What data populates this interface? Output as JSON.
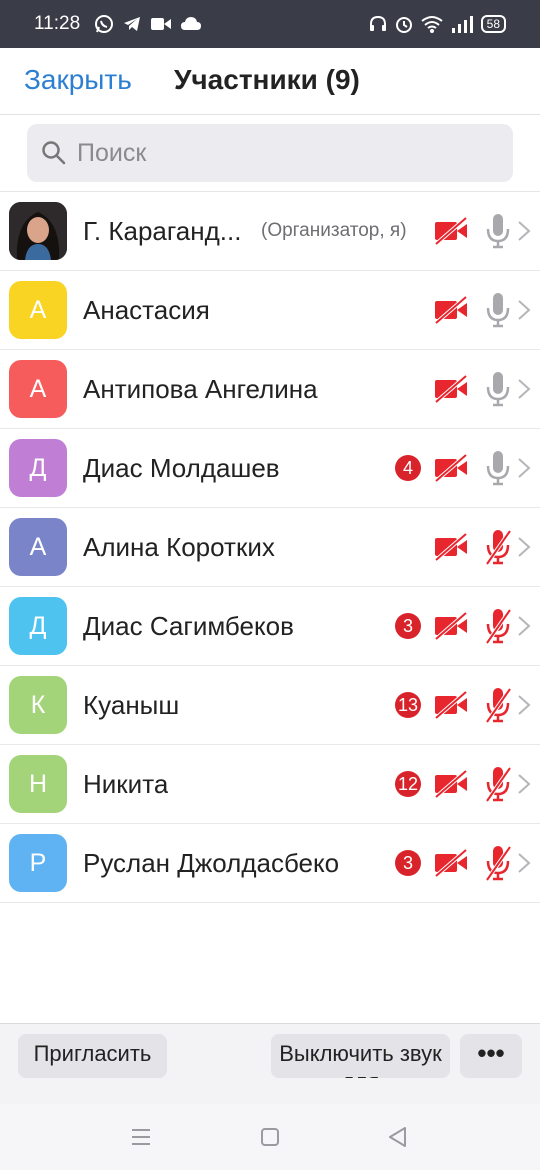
{
  "status": {
    "time": "11:28",
    "battery": "58",
    "left_icons": [
      "whatsapp-icon",
      "telegram-icon",
      "video-icon",
      "cloud-icon"
    ],
    "right_icons": [
      "headphones-icon",
      "alarm-icon",
      "wifi-icon",
      "signal-icon",
      "battery-icon"
    ]
  },
  "header": {
    "close_label": "Закрыть",
    "title": "Участники (9)"
  },
  "search": {
    "placeholder": "Поиск",
    "value": ""
  },
  "colors": {
    "accent": "#2d7fd1",
    "muted_red": "#e8262e",
    "badge_red": "#d8232a",
    "mic_gray": "#a9a9ad"
  },
  "participants": [
    {
      "name": "Г. Караганд...",
      "role": "(Организатор, я)",
      "initial": "",
      "avatar_color": "#2b2b2b",
      "photo": true,
      "unread": "",
      "video_off": true,
      "mic_muted": false
    },
    {
      "name": "Анастасия",
      "role": "",
      "initial": "А",
      "avatar_color": "#f9d423",
      "photo": false,
      "unread": "",
      "video_off": true,
      "mic_muted": false
    },
    {
      "name": "Антипова Ангелина",
      "role": "",
      "initial": "А",
      "avatar_color": "#f65c5c",
      "photo": false,
      "unread": "",
      "video_off": true,
      "mic_muted": false
    },
    {
      "name": "Диас Молдашев",
      "role": "",
      "initial": "Д",
      "avatar_color": "#c07ed4",
      "photo": false,
      "unread": "4",
      "video_off": true,
      "mic_muted": false
    },
    {
      "name": "Алина Коротких",
      "role": "",
      "initial": "А",
      "avatar_color": "#7a85c9",
      "photo": false,
      "unread": "",
      "video_off": true,
      "mic_muted": true
    },
    {
      "name": "Диас Сагимбеков",
      "role": "",
      "initial": "Д",
      "avatar_color": "#4fc3f0",
      "photo": false,
      "unread": "3",
      "video_off": true,
      "mic_muted": true
    },
    {
      "name": "Куаныш",
      "role": "",
      "initial": "К",
      "avatar_color": "#a3d47a",
      "photo": false,
      "unread": "13",
      "video_off": true,
      "mic_muted": true
    },
    {
      "name": "Никита",
      "role": "",
      "initial": "Н",
      "avatar_color": "#a3d47a",
      "photo": false,
      "unread": "12",
      "video_off": true,
      "mic_muted": true
    },
    {
      "name": "Руслан Джолдасбеко",
      "role": "",
      "initial": "Р",
      "avatar_color": "#5fb3f2",
      "photo": false,
      "unread": "3",
      "video_off": true,
      "mic_muted": true
    }
  ],
  "toolbar": {
    "invite_label": "Пригласить",
    "mute_all_label": "Выключить звук для",
    "more_label": "•••"
  },
  "navbar": {
    "icons": [
      "menu-icon",
      "home-square-icon",
      "back-triangle-icon"
    ]
  }
}
